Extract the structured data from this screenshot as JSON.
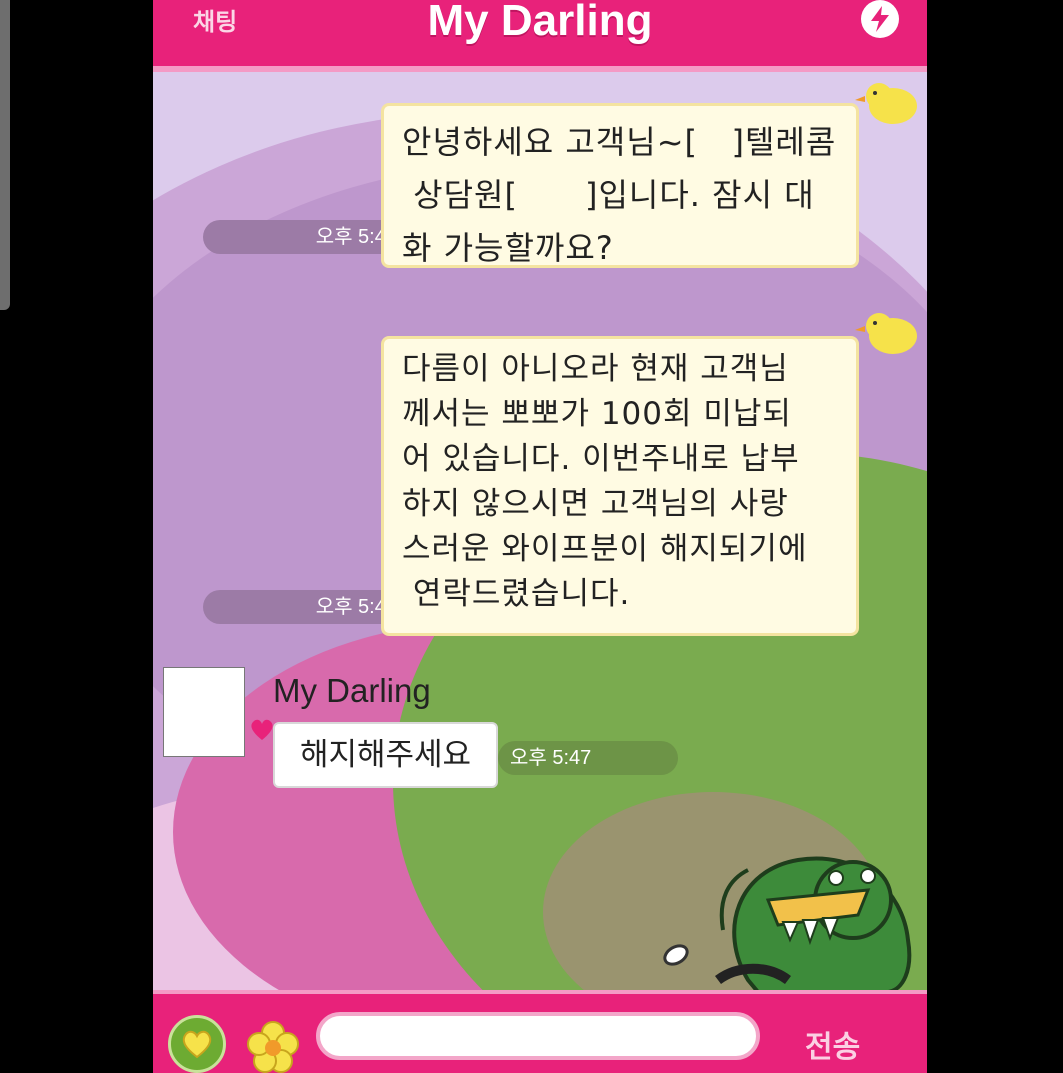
{
  "header": {
    "back_label": "채팅",
    "title": "My Darling"
  },
  "messages": [
    {
      "direction": "out",
      "lines": [
        "안녕하세요 고객님~[   ]텔레콤",
        " 상담원[      ]입니다. 잠시 대",
        "화 가능할까요?"
      ],
      "time": "오후 5:45"
    },
    {
      "direction": "out",
      "lines": [
        "다름이 아니오라 현재 고객님",
        "께서는 뽀뽀가 100회 미납되",
        "어 있습니다. 이번주내로 납부",
        "하지 않으시면 고객님의 사랑",
        "스러운 와이프분이 해지되기에",
        " 연락드렸습니다."
      ],
      "time": "오후 5:46"
    },
    {
      "direction": "in",
      "sender": "My Darling",
      "text": "해지해주세요",
      "time": "오후 5:47"
    }
  ],
  "composer": {
    "input_value": "",
    "send_label": "전송"
  },
  "colors": {
    "header": "#e8227a",
    "bubble_out": "#fffbe3",
    "time_out": "#9c7ba6",
    "time_in": "#6d9447",
    "bg_green": "#7aab4f"
  },
  "icons": {
    "header_right": "lightning-icon",
    "composer_left_1": "heart-icon",
    "composer_left_2": "flower-icon"
  }
}
